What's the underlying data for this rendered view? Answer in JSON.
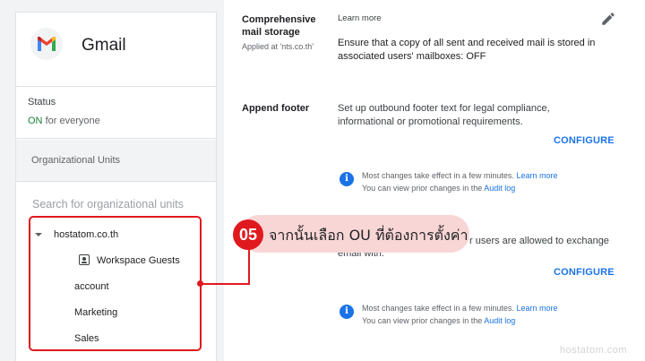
{
  "app": {
    "name": "Gmail",
    "status_label": "Status",
    "status_on": "ON",
    "status_scope": "for everyone"
  },
  "org_units": {
    "header": "Organizational Units",
    "search_placeholder": "Search for organizational units",
    "items": [
      "hostatom.co.th",
      "Workspace Guests",
      "account",
      "Marketing",
      "Sales"
    ]
  },
  "settings": {
    "comprehensive": {
      "title_line1": "Comprehensive",
      "title_line2": "mail storage",
      "applied": "Applied at 'nts.co.th'",
      "learn_more": "Learn more",
      "desc_line1": "Ensure that a copy of all sent and received mail is stored in",
      "desc_line2": "associated users' mailboxes: OFF"
    },
    "append_footer": {
      "title": "Append footer",
      "desc_line1": "Set up outbound footer text for legal compliance,",
      "desc_line2": "informational or promotional requirements.",
      "configure": "CONFIGURE"
    },
    "note1": {
      "line1": "Most changes take effect in a few minutes.",
      "learn_more": "Learn more",
      "line2": "You can view prior changes in the",
      "audit_log": "Audit log"
    },
    "partial": {
      "line1": "r users are allowed to exchange",
      "line2": "email with.",
      "configure": "CONFIGURE"
    },
    "note2": {
      "line1": "Most changes take effect in a few minutes.",
      "learn_more": "Learn more",
      "line2": "You can view prior changes in the",
      "audit_log": "Audit log"
    }
  },
  "callout": {
    "step": "05",
    "text": "จากนั้นเลือก OU ที่ต้องการตั้งค่า"
  },
  "watermark": "hostatom.com",
  "colors": {
    "accent": "#1a73e8",
    "on_green": "#188038",
    "highlight_red": "#e0191e",
    "callout_pink": "#f9d6d6"
  }
}
